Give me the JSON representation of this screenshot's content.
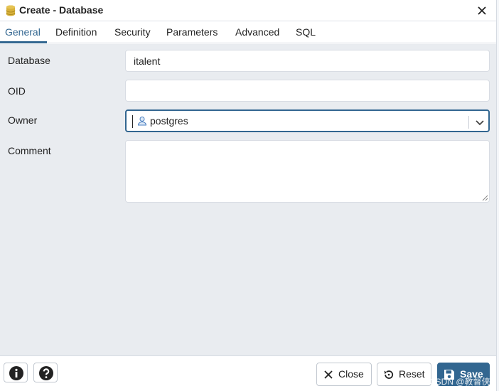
{
  "window": {
    "title": "Create - Database",
    "icon": "database-icon",
    "close_icon": "close-icon"
  },
  "tabs": [
    {
      "label": "General",
      "active": true
    },
    {
      "label": "Definition",
      "active": false
    },
    {
      "label": "Security",
      "active": false
    },
    {
      "label": "Parameters",
      "active": false
    },
    {
      "label": "Advanced",
      "active": false
    },
    {
      "label": "SQL",
      "active": false
    }
  ],
  "form": {
    "database": {
      "label": "Database",
      "value": "italent"
    },
    "oid": {
      "label": "OID",
      "value": ""
    },
    "owner": {
      "label": "Owner",
      "value": "postgres",
      "icon": "user-icon"
    },
    "comment": {
      "label": "Comment",
      "value": ""
    }
  },
  "footer": {
    "info_icon": "info-icon",
    "help_icon": "help-icon",
    "close_label": "Close",
    "reset_label": "Reset",
    "save_label": "Save"
  },
  "watermark": "CSDN @教督侠",
  "colors": {
    "accent": "#326690",
    "content_bg": "#e9ecf0",
    "border": "#d8dce3"
  }
}
